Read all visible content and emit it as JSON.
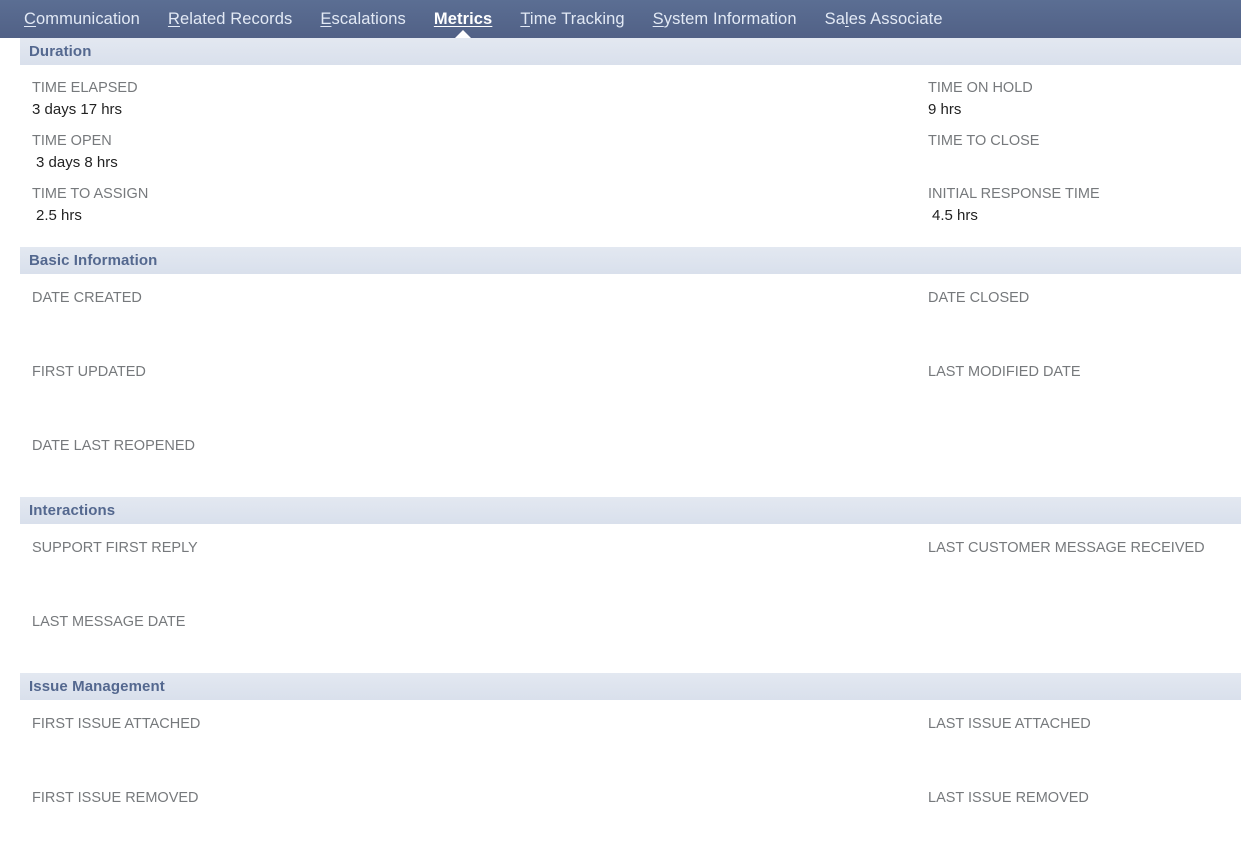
{
  "tabs": [
    {
      "id": "communication",
      "label": "Communication",
      "accesskey": "C",
      "active": false
    },
    {
      "id": "related-records",
      "label": "Related Records",
      "accesskey": "R",
      "active": false
    },
    {
      "id": "escalations",
      "label": "Escalations",
      "accesskey": "E",
      "active": false
    },
    {
      "id": "metrics",
      "label": "Metrics",
      "accesskey": "M",
      "active": true
    },
    {
      "id": "time-tracking",
      "label": "Time Tracking",
      "accesskey": "T",
      "active": false
    },
    {
      "id": "system-information",
      "label": "System Information",
      "accesskey": "S",
      "active": false
    },
    {
      "id": "sales-associate",
      "label": "Sales Associate",
      "accesskey": "l",
      "active": false
    }
  ],
  "sections": [
    {
      "id": "duration",
      "title": "Duration",
      "rows": [
        {
          "left": {
            "label": "TIME ELAPSED",
            "value": "3 days 17 hrs",
            "indent": false
          },
          "right": {
            "label": "TIME ON HOLD",
            "value": "9 hrs",
            "indent": false
          }
        },
        {
          "left": {
            "label": "TIME OPEN",
            "value": "3 days 8 hrs",
            "indent": true
          },
          "right": {
            "label": "TIME TO CLOSE",
            "value": "",
            "indent": false
          }
        },
        {
          "left": {
            "label": "TIME TO ASSIGN",
            "value": "2.5 hrs",
            "indent": true
          },
          "right": {
            "label": "INITIAL RESPONSE TIME",
            "value": "4.5 hrs",
            "indent": true
          }
        }
      ]
    },
    {
      "id": "basic-information",
      "title": "Basic Information",
      "rows": [
        {
          "left": {
            "label": "DATE CREATED",
            "value": "",
            "indent": false
          },
          "right": {
            "label": "DATE CLOSED",
            "value": "",
            "indent": false
          }
        },
        {
          "left": {
            "label": "FIRST UPDATED",
            "value": "",
            "indent": false
          },
          "right": {
            "label": "LAST MODIFIED DATE",
            "value": "",
            "indent": false
          }
        },
        {
          "left": {
            "label": "DATE LAST REOPENED",
            "value": "",
            "indent": false
          },
          "right": {
            "label": "",
            "value": "",
            "indent": false
          }
        }
      ]
    },
    {
      "id": "interactions",
      "title": "Interactions",
      "rows": [
        {
          "left": {
            "label": "SUPPORT FIRST REPLY",
            "value": "",
            "indent": false
          },
          "right": {
            "label": "LAST CUSTOMER MESSAGE RECEIVED",
            "value": "",
            "indent": false
          }
        },
        {
          "left": {
            "label": "LAST MESSAGE DATE",
            "value": "",
            "indent": false
          },
          "right": {
            "label": "",
            "value": "",
            "indent": false
          }
        }
      ]
    },
    {
      "id": "issue-management",
      "title": "Issue Management",
      "rows": [
        {
          "left": {
            "label": "FIRST ISSUE ATTACHED",
            "value": "",
            "indent": false
          },
          "right": {
            "label": "LAST ISSUE ATTACHED",
            "value": "",
            "indent": false
          }
        },
        {
          "left": {
            "label": "FIRST ISSUE REMOVED",
            "value": "",
            "indent": false
          },
          "right": {
            "label": "LAST ISSUE REMOVED",
            "value": "",
            "indent": false
          }
        }
      ]
    }
  ],
  "colors": {
    "tabbar_bg": "#55658a",
    "tab_inactive_text": "#e2e9f5",
    "tab_active_text": "#ffffff",
    "section_header_bg": "#dde3ee",
    "section_header_text": "#54688f",
    "field_label_text": "#76797c",
    "field_value_text": "#222222",
    "page_bg": "#ffffff"
  }
}
